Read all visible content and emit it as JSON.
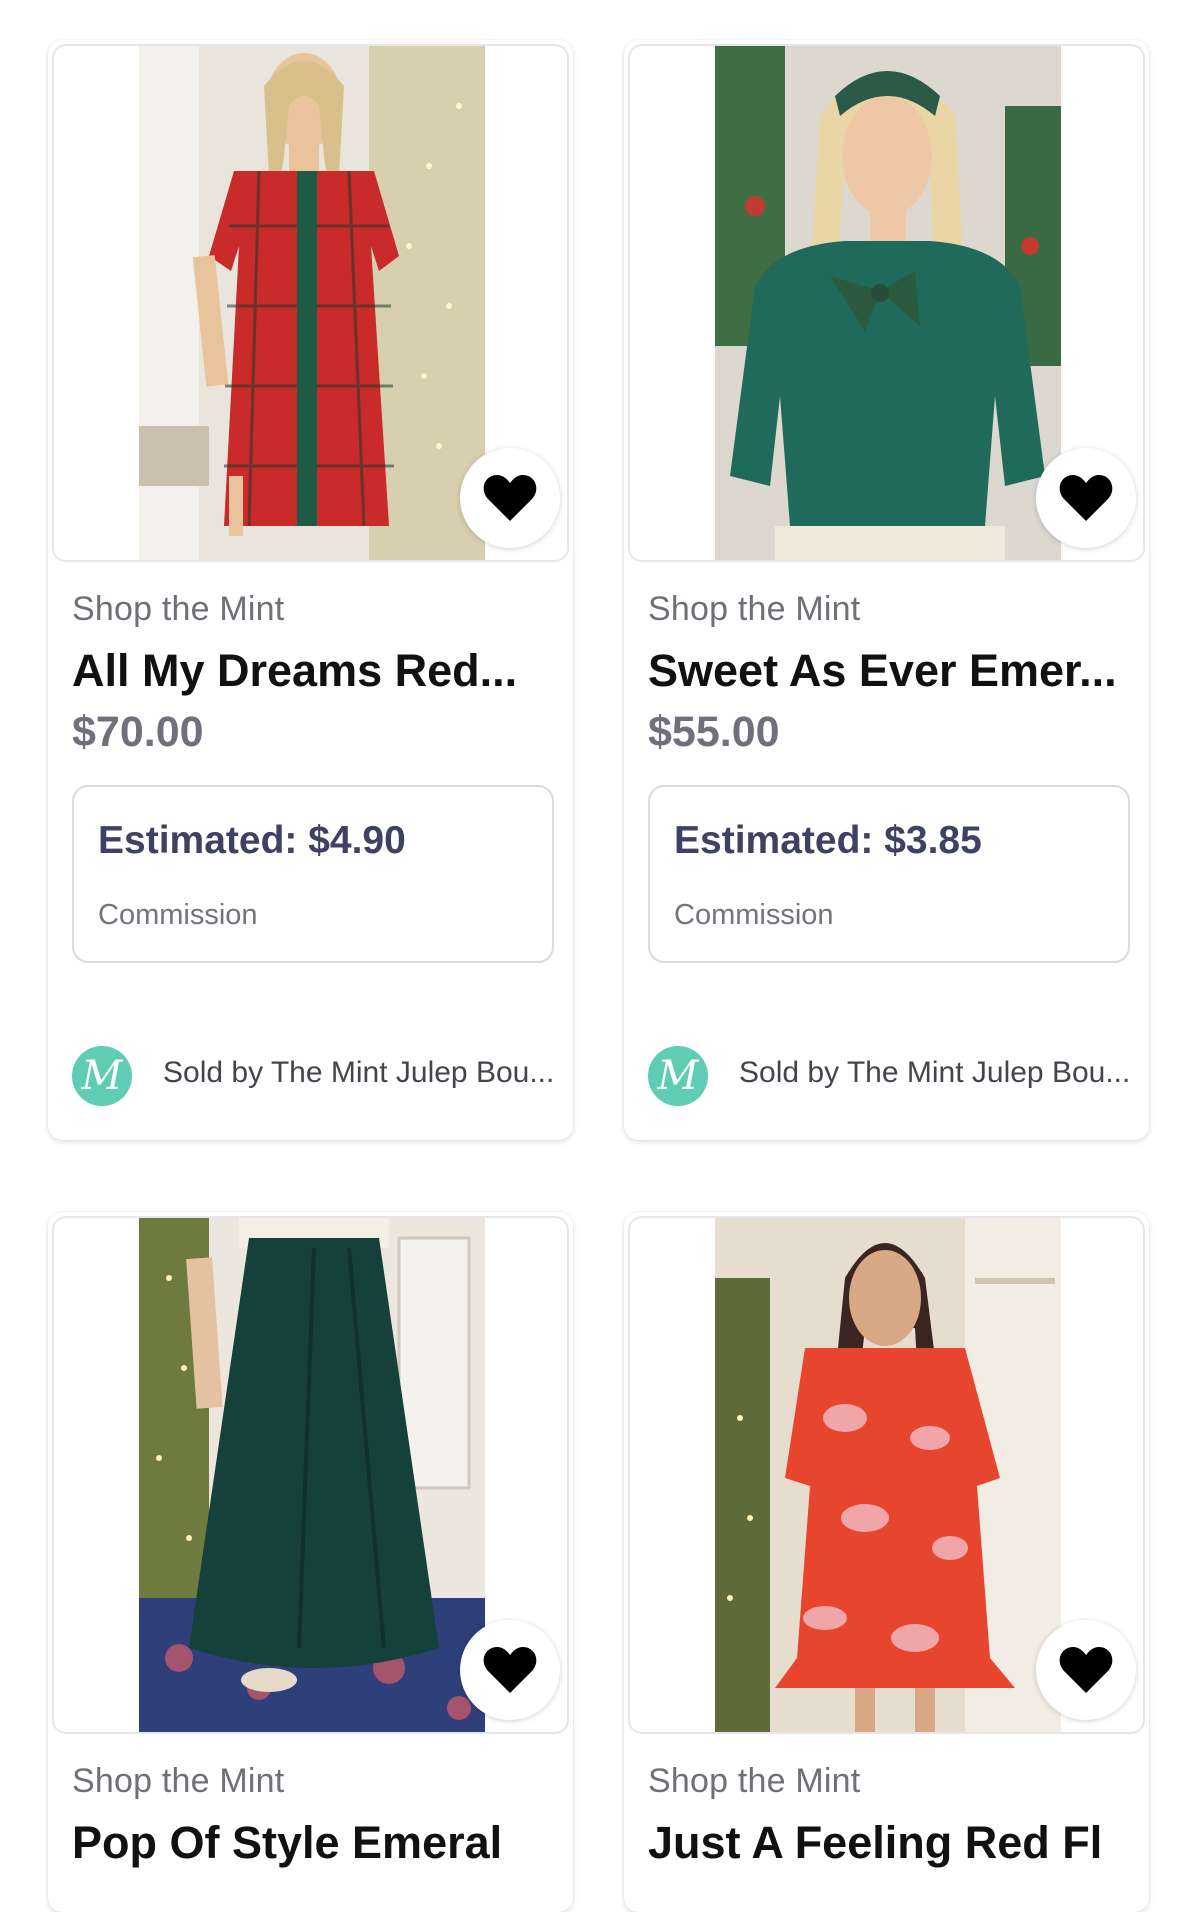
{
  "products": [
    {
      "shop": "Shop the Mint",
      "title": "All My Dreams Red...",
      "price": "$70.00",
      "estimated": "Estimated: $4.90",
      "commission_label": "Commission",
      "seller": "Sold by The Mint Julep Bou...",
      "seller_initial": "M",
      "heart_icon": "heart-icon"
    },
    {
      "shop": "Shop the Mint",
      "title": "Sweet As Ever Emer...",
      "price": "$55.00",
      "estimated": "Estimated: $3.85",
      "commission_label": "Commission",
      "seller": "Sold by The Mint Julep Bou...",
      "seller_initial": "M",
      "heart_icon": "heart-icon"
    },
    {
      "shop": "Shop the Mint",
      "title": "Pop Of Style Emeral",
      "heart_icon": "heart-icon"
    },
    {
      "shop": "Shop the Mint",
      "title": "Just A Feeling Red Fl",
      "heart_icon": "heart-icon"
    }
  ],
  "colors": {
    "accent_avatar": "#5ecdb4",
    "price_text": "#70707c",
    "estimated_text": "#3e4163"
  }
}
